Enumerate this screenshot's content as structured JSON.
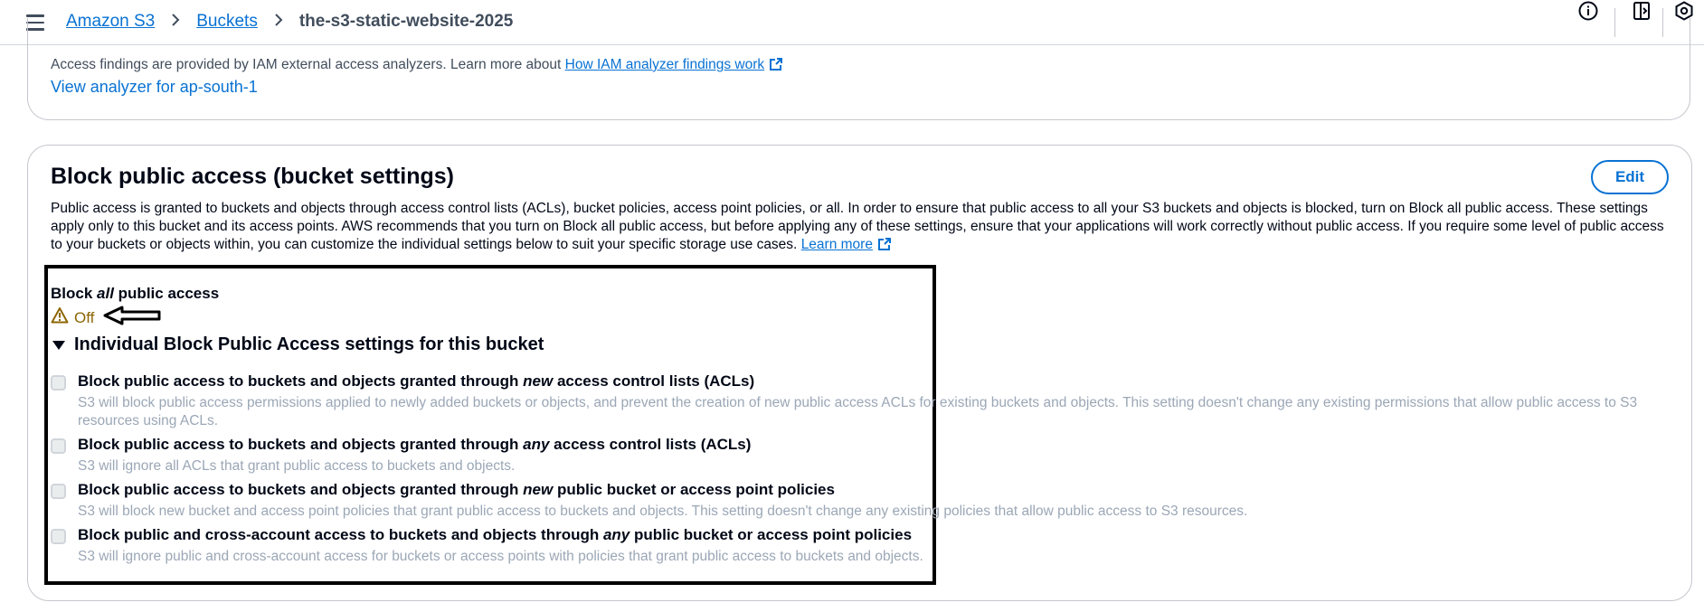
{
  "header": {
    "breadcrumbs": [
      "Amazon S3",
      "Buckets",
      "the-s3-static-website-2025"
    ],
    "icons": [
      "menu-icon",
      "info-icon",
      "notifications-panel-icon",
      "settings-icon"
    ]
  },
  "access_findings": {
    "text": "Access findings are provided by IAM external access analyzers. Learn more about",
    "link": "How IAM analyzer findings work",
    "analyzer_link": "View analyzer for ap-south-1"
  },
  "block_public_access": {
    "title": "Block public access (bucket settings)",
    "edit_label": "Edit",
    "description": "Public access is granted to buckets and objects through access control lists (ACLs), bucket policies, access point policies, or all. In order to ensure that public access to all your S3 buckets and objects is blocked, turn on Block all public access. These settings apply only to this bucket and its access points. AWS recommends that you turn on Block all public access, but before applying any of these settings, ensure that your applications will work correctly without public access. If you require some level of public access to your buckets or objects within, you can customize the individual settings below to suit your specific storage use cases.",
    "learn_more": "Learn more",
    "block_all": {
      "pre": "Block ",
      "em": "all",
      "post": " public access"
    },
    "status": "Off",
    "status_color": "#8d6605",
    "individual_heading": "Individual Block Public Access settings for this bucket",
    "options": [
      {
        "pre": "Block public access to buckets and objects granted through ",
        "em": "new",
        "post": " access control lists (ACLs)",
        "desc": "S3 will block public access permissions applied to newly added buckets or objects, and prevent the creation of new public access ACLs for existing buckets and objects. This setting doesn't change any existing permissions that allow public access to S3 resources using ACLs.",
        "checked": false
      },
      {
        "pre": "Block public access to buckets and objects granted through ",
        "em": "any",
        "post": " access control lists (ACLs)",
        "desc": "S3 will ignore all ACLs that grant public access to buckets and objects.",
        "checked": false
      },
      {
        "pre": "Block public access to buckets and objects granted through ",
        "em": "new",
        "post": " public bucket or access point policies",
        "desc": "S3 will block new bucket and access point policies that grant public access to buckets and objects. This setting doesn't change any existing policies that allow public access to S3 resources.",
        "checked": false
      },
      {
        "pre": "Block public and cross-account access to buckets and objects through ",
        "em": "any",
        "post": " public bucket or access point policies",
        "desc": "S3 will ignore public and cross-account access for buckets or access points with policies that grant public access to buckets and objects.",
        "checked": false
      }
    ]
  }
}
